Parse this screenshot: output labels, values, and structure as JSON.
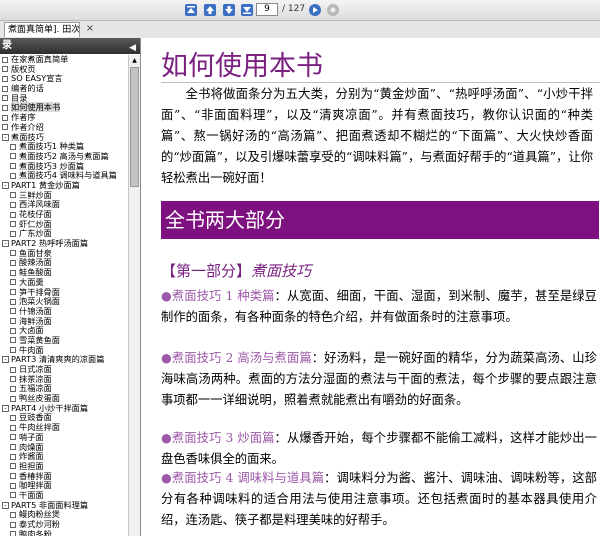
{
  "toolbar": {
    "current_page": "9",
    "page_total": "/ 127"
  },
  "tab": {
    "title": "煮面真简单]. 田次枝...",
    "close": "×"
  },
  "sidebar": {
    "header": "录",
    "items": [
      {
        "label": "在家煮面真简单",
        "level": 1,
        "toggle": ""
      },
      {
        "label": "版权页",
        "level": 1,
        "toggle": ""
      },
      {
        "label": "SO  EASY宣言",
        "level": 1,
        "toggle": ""
      },
      {
        "label": "编者的话",
        "level": 1,
        "toggle": ""
      },
      {
        "label": "目录",
        "level": 1,
        "toggle": ""
      },
      {
        "label": "如何使用本书",
        "level": 1,
        "toggle": "",
        "selected": true
      },
      {
        "label": "作者序",
        "level": 1,
        "toggle": ""
      },
      {
        "label": "作者介绍",
        "level": 1,
        "toggle": ""
      },
      {
        "label": "煮面技巧",
        "level": 1,
        "toggle": "-"
      },
      {
        "label": "煮面技巧1  种类篇",
        "level": 2,
        "toggle": ""
      },
      {
        "label": "煮面技巧2  高汤与煮面篇",
        "level": 2,
        "toggle": ""
      },
      {
        "label": "煮面技巧3  炒面篇",
        "level": 2,
        "toggle": ""
      },
      {
        "label": "煮面技巧4  调味料与道具篇",
        "level": 2,
        "toggle": ""
      },
      {
        "label": "PART1  黄金炒面篇",
        "level": 1,
        "toggle": "-"
      },
      {
        "label": "三鲜炒面",
        "level": 2,
        "toggle": ""
      },
      {
        "label": "西洋风味面",
        "level": 2,
        "toggle": ""
      },
      {
        "label": "花枝仔面",
        "level": 2,
        "toggle": ""
      },
      {
        "label": "虾仁炒面",
        "level": 2,
        "toggle": ""
      },
      {
        "label": "广东炒面",
        "level": 2,
        "toggle": ""
      },
      {
        "label": "PART2  热呼呼汤面篇",
        "level": 1,
        "toggle": "-"
      },
      {
        "label": "鱼面甘泉",
        "level": 2,
        "toggle": ""
      },
      {
        "label": "酸辣汤面",
        "level": 2,
        "toggle": ""
      },
      {
        "label": "鲑鱼酸面",
        "level": 2,
        "toggle": ""
      },
      {
        "label": "大面羹",
        "level": 2,
        "toggle": ""
      },
      {
        "label": "笋干排骨面",
        "level": 2,
        "toggle": ""
      },
      {
        "label": "泡菜火锅面",
        "level": 2,
        "toggle": ""
      },
      {
        "label": "什锦汤面",
        "level": 2,
        "toggle": ""
      },
      {
        "label": "海鲜汤面",
        "level": 2,
        "toggle": ""
      },
      {
        "label": "大卤面",
        "level": 2,
        "toggle": ""
      },
      {
        "label": "雪菜黄鱼面",
        "level": 2,
        "toggle": ""
      },
      {
        "label": "牛肉面",
        "level": 2,
        "toggle": ""
      },
      {
        "label": "PART3  清清爽爽的凉面篇",
        "level": 1,
        "toggle": "-"
      },
      {
        "label": "日式凉面",
        "level": 2,
        "toggle": ""
      },
      {
        "label": "抹茶凉面",
        "level": 2,
        "toggle": ""
      },
      {
        "label": "五福凉面",
        "level": 2,
        "toggle": ""
      },
      {
        "label": "鸭丝皮蛋面",
        "level": 2,
        "toggle": ""
      },
      {
        "label": "PART4  小炒干拌面篇",
        "level": 1,
        "toggle": "-"
      },
      {
        "label": "豆豉香面",
        "level": 2,
        "toggle": ""
      },
      {
        "label": "牛肉丝拌面",
        "level": 2,
        "toggle": ""
      },
      {
        "label": "哨子面",
        "level": 2,
        "toggle": ""
      },
      {
        "label": "肉燥面",
        "level": 2,
        "toggle": ""
      },
      {
        "label": "炸酱面",
        "level": 2,
        "toggle": ""
      },
      {
        "label": "担担面",
        "level": 2,
        "toggle": ""
      },
      {
        "label": "香椿拌面",
        "level": 2,
        "toggle": ""
      },
      {
        "label": "咖哩拌面",
        "level": 2,
        "toggle": ""
      },
      {
        "label": "干面面",
        "level": 2,
        "toggle": ""
      },
      {
        "label": "PART5  非面面料理篇",
        "level": 1,
        "toggle": "-"
      },
      {
        "label": "鳗肉粉丝煲",
        "level": 2,
        "toggle": ""
      },
      {
        "label": "泰式炒河粉",
        "level": 2,
        "toggle": ""
      },
      {
        "label": "鸭肉冬粉",
        "level": 2,
        "toggle": ""
      }
    ]
  },
  "content": {
    "title": "如何使用本书",
    "intro": "全书将做面条分为五大类，分别为“黄金炒面”、“热呼呼汤面”、“小炒干拌面”、“非面面料理”，以及“清爽凉面”。并有煮面技巧，教你认识面的“种类篇”、熬一锅好汤的“高汤篇”、把面煮透却不糊烂的“下面篇”、大火快炒香面的“炒面篇”，以及引爆味蕾享受的“调味料篇”，与煮面好帮手的“道具篇”，让你轻松煮出一碗好面！",
    "banner": "全书两大部分",
    "section_head_bracket": "【第一部分】",
    "section_head_text": "煮面技巧",
    "paragraphs": [
      {
        "label": "煮面技巧 1 种类篇",
        "text": "：从宽面、细面，干面、湿面，到米制、魔芋，甚至是绿豆制作的面条，有各种面条的特色介绍，并有做面条时的注意事项。"
      },
      {
        "label": "煮面技巧 2 高汤与煮面篇",
        "text": "：好汤料，是一碗好面的精华，分为蔬菜高汤、山珍海味高汤两种。煮面的方法分湿面的煮法与干面的煮法，每个步骤的要点跟注意事项都一一详细说明，照着煮就能煮出有嚼劲的好面条。"
      },
      {
        "label": "煮面技巧 3 炒面篇",
        "text": "：从爆香开始，每个步骤都不能偷工减料，这样才能炒出一盘色香味俱全的面来。"
      },
      {
        "label": "煮面技巧 4 调味料与道具篇",
        "text": "：调味料分为酱、酱汁、调味油、调味粉等，这部分有各种调味料的适合用法与使用注意事项。还包括煮面时的基本器具使用介绍，连汤匙、筷子都是料理美味的好帮手。"
      }
    ]
  }
}
